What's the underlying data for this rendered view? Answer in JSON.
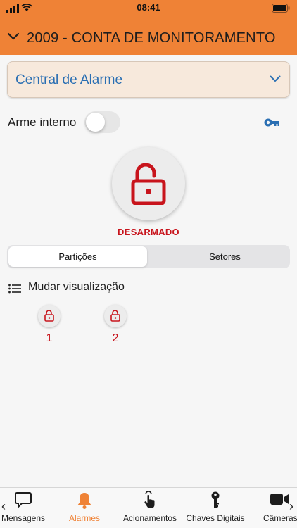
{
  "status_bar": {
    "time": "08:41"
  },
  "header": {
    "title": "2009 - CONTA DE MONITORAMENTO"
  },
  "central_select": {
    "value": "Central de Alarme"
  },
  "arme_interno": {
    "label": "Arme interno",
    "enabled": false
  },
  "alarm": {
    "state": "DESARMADO",
    "state_color": "#c8141c"
  },
  "segments": {
    "options": [
      "Partições",
      "Setores"
    ],
    "selected": "Partições"
  },
  "view_toggle": {
    "label": "Mudar visualização"
  },
  "partitions": [
    {
      "number": "1",
      "locked": false
    },
    {
      "number": "2",
      "locked": false
    }
  ],
  "tabbar": {
    "tabs": [
      {
        "label": "Mensagens",
        "icon": "chat-bubble-icon"
      },
      {
        "label": "Alarmes",
        "icon": "bell-icon",
        "active": true
      },
      {
        "label": "Acionamentos",
        "icon": "touch-hand-icon"
      },
      {
        "label": "Chaves Digitais",
        "icon": "key-icon"
      },
      {
        "label": "Câmeras",
        "icon": "video-camera-icon"
      }
    ],
    "prev_arrow": "‹",
    "next_arrow": "›"
  },
  "colors": {
    "accent": "#ef8236",
    "link_blue": "#2a6fb3",
    "danger": "#c8141c"
  }
}
